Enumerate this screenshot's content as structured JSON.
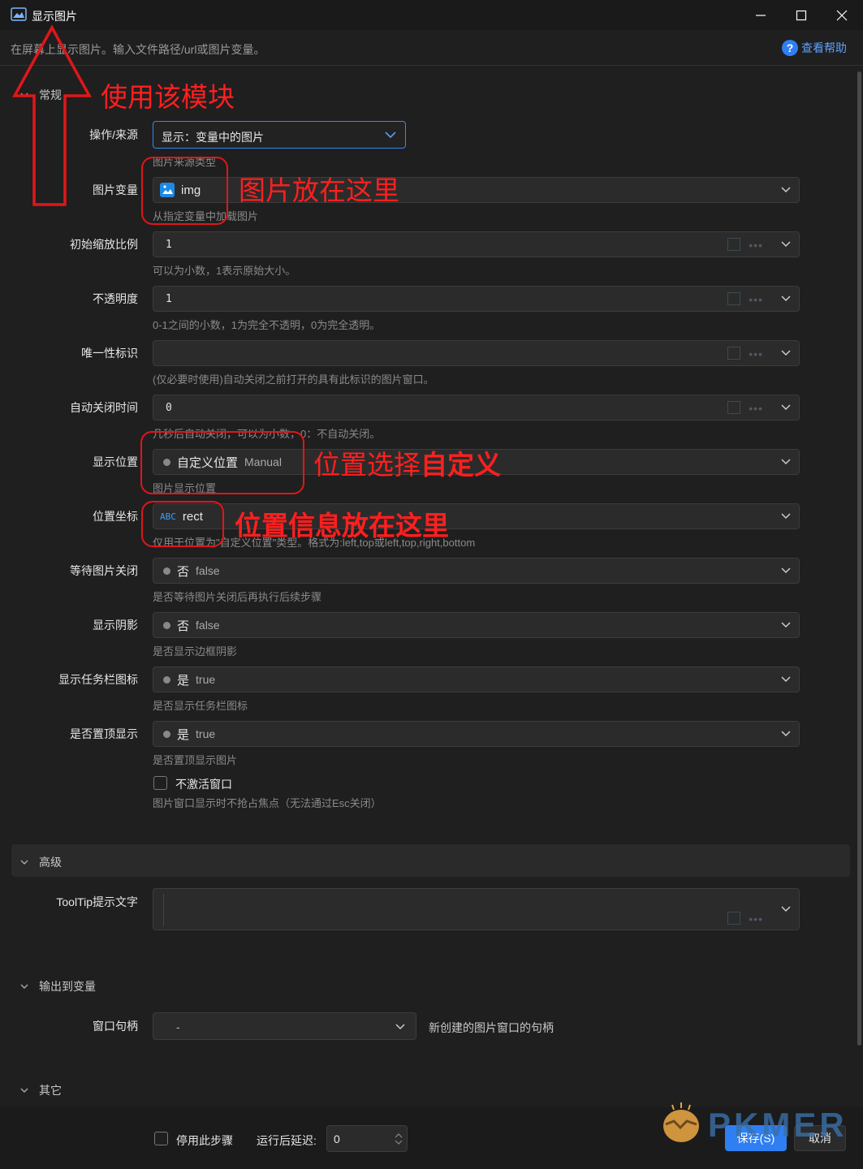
{
  "window": {
    "title": "显示图片"
  },
  "desc": "在屏幕上显示图片。输入文件路径/url或图片变量。",
  "help_label": "查看帮助",
  "sections": {
    "general": "常规",
    "advanced": "高级",
    "output": "输出到变量",
    "other": "其它"
  },
  "fields": {
    "op_source": {
      "label": "操作/来源",
      "value": "显示：变量中的图片",
      "hint": "图片来源类型"
    },
    "img_var": {
      "label": "图片变量",
      "value": "img",
      "hint": "从指定变量中加载图片"
    },
    "scale": {
      "label": "初始缩放比例",
      "value": "1",
      "hint": "可以为小数，1表示原始大小。"
    },
    "opacity": {
      "label": "不透明度",
      "value": "1",
      "hint": "0-1之间的小数，1为完全不透明，0为完全透明。"
    },
    "unique_id": {
      "label": "唯一性标识",
      "value": "",
      "hint": "(仅必要时使用)自动关闭之前打开的具有此标识的图片窗口。"
    },
    "auto_close": {
      "label": "自动关闭时间",
      "value": "0",
      "hint": "几秒后自动关闭，可以为小数，0：不自动关闭。"
    },
    "position": {
      "label": "显示位置",
      "value": "自定义位置",
      "sub": "Manual",
      "hint": "图片显示位置"
    },
    "coords": {
      "label": "位置坐标",
      "badge": "ABC",
      "value": "rect",
      "hint": "仅用于位置为\"自定义位置\"类型。格式为:left,top或left,top,right,bottom"
    },
    "wait_close": {
      "label": "等待图片关闭",
      "value": "否",
      "sub": "false",
      "hint": "是否等待图片关闭后再执行后续步骤"
    },
    "shadow": {
      "label": "显示阴影",
      "value": "否",
      "sub": "false",
      "hint": "是否显示边框阴影"
    },
    "taskbar": {
      "label": "显示任务栏图标",
      "value": "是",
      "sub": "true",
      "hint": "是否显示任务栏图标"
    },
    "topmost": {
      "label": "是否置顶显示",
      "value": "是",
      "sub": "true",
      "hint": "是否置顶显示图片"
    },
    "no_activate": {
      "label": "不激活窗口",
      "hint": "图片窗口显示时不抢占焦点（无法通过Esc关闭）"
    },
    "tooltip": {
      "label": "ToolTip提示文字",
      "value": ""
    },
    "handle": {
      "label": "窗口句柄",
      "value": "-",
      "desc": "新创建的图片窗口的句柄"
    }
  },
  "footer": {
    "disable_label": "停用此步骤",
    "delay_label": "运行后延迟:",
    "delay_value": "0",
    "save_label": "保存(S)",
    "cancel_label": "取消"
  },
  "annotations": {
    "use_module": "使用该模块",
    "img_here": "图片放在这里",
    "pos_select_prefix": "位置选择",
    "pos_select_bold": "自定义",
    "pos_info": "位置信息放在这里"
  },
  "watermark": "PKMER",
  "colors": {
    "accent": "#2f7ff2",
    "annotation": "#ff1f1f",
    "background": "#1f1f1f"
  },
  "icons": [
    "image-icon",
    "minimize-icon",
    "maximize-icon",
    "close-icon",
    "help-icon",
    "chevron-down-icon",
    "expand-icon",
    "more-icon",
    "up-arrow-annotation"
  ]
}
